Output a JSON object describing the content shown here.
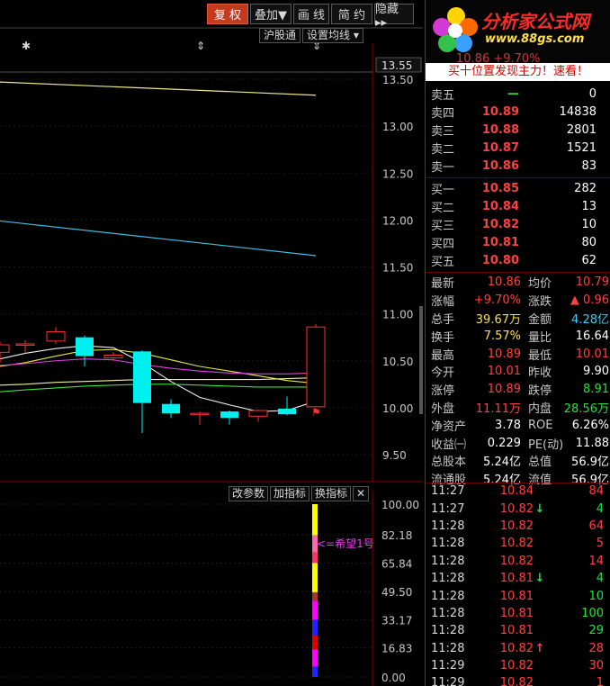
{
  "toolbar": {
    "buttons": [
      "复 权",
      "叠加▼",
      "画 线",
      "简 约",
      "隐藏 ▸▸"
    ]
  },
  "chart_header": {
    "hgt": "沪股通",
    "ma_setting": "设置均线 ▾",
    "markers": [
      "✱",
      "⇕",
      "⇕"
    ]
  },
  "price_axis": {
    "current": "13.55",
    "ticks": [
      "13.50",
      "13.00",
      "12.50",
      "12.00",
      "11.50",
      "11.00",
      "10.50",
      "10.00",
      "9.50"
    ]
  },
  "indicator_axis": {
    "ticks": [
      "100.00",
      "82.18",
      "65.84",
      "49.50",
      "33.17",
      "16.83",
      "0.00"
    ]
  },
  "indicator_toolbar": {
    "buttons": [
      "改参数",
      "加指标",
      "换指标"
    ],
    "close": "✕"
  },
  "indicator_label": "<=希望1号",
  "limit_flag": "⚑",
  "chart_data": {
    "type": "candlestick",
    "candles": [
      {
        "open": 10.59,
        "close": 10.67,
        "high": 10.7,
        "low": 10.48,
        "color": "red"
      },
      {
        "open": 10.67,
        "close": 10.68,
        "high": 10.72,
        "low": 10.58,
        "color": "red"
      },
      {
        "open": 10.71,
        "close": 10.81,
        "high": 10.86,
        "low": 10.68,
        "color": "red"
      },
      {
        "open": 10.75,
        "close": 10.55,
        "high": 10.77,
        "low": 10.44,
        "color": "cyan"
      },
      {
        "open": 10.56,
        "close": 10.53,
        "high": 10.59,
        "low": 10.5,
        "color": "red"
      },
      {
        "open": 10.6,
        "close": 10.05,
        "high": 10.61,
        "low": 9.73,
        "color": "cyan"
      },
      {
        "open": 10.04,
        "close": 9.94,
        "high": 10.09,
        "low": 9.89,
        "color": "cyan"
      },
      {
        "open": 9.93,
        "close": 9.94,
        "high": 9.96,
        "low": 9.82,
        "color": "red"
      },
      {
        "open": 9.96,
        "close": 9.89,
        "high": 9.97,
        "low": 9.82,
        "color": "cyan"
      },
      {
        "open": 9.91,
        "close": 9.97,
        "high": 9.98,
        "low": 9.85,
        "color": "red"
      },
      {
        "open": 9.99,
        "close": 9.93,
        "high": 10.12,
        "low": 9.92,
        "color": "cyan"
      },
      {
        "open": 10.01,
        "close": 10.86,
        "high": 10.89,
        "low": 10.01,
        "color": "red"
      }
    ],
    "ma_lines": [
      {
        "color": "#f0f0f0",
        "values": [
          10.52,
          10.58,
          10.63,
          10.66,
          10.64,
          10.48,
          10.28,
          10.11,
          10.03,
          9.96,
          9.97,
          10.07
        ]
      },
      {
        "color": "#e8e840",
        "values": [
          10.44,
          10.48,
          10.55,
          10.61,
          10.62,
          10.58,
          10.51,
          10.44,
          10.39,
          10.34,
          10.29,
          10.26
        ]
      },
      {
        "color": "#e040e0",
        "values": [
          10.45,
          10.47,
          10.5,
          10.52,
          10.51,
          10.46,
          10.42,
          10.39,
          10.37,
          10.36,
          10.36,
          10.37
        ]
      },
      {
        "color": "#40e040",
        "values": [
          10.17,
          10.19,
          10.21,
          10.23,
          10.24,
          10.25,
          10.25,
          10.24,
          10.23,
          10.22,
          10.22,
          10.22
        ]
      },
      {
        "color": "#f0f0a0",
        "values": [
          10.24,
          10.25,
          10.27,
          10.28,
          10.29,
          10.3,
          10.3,
          10.3,
          10.3,
          10.3,
          10.31,
          10.32
        ]
      }
    ],
    "long_ma_lines": [
      {
        "color": "#f0e68c",
        "from": 13.47,
        "to": 13.33
      },
      {
        "color": "#40c0e0",
        "from": 11.99,
        "to": 11.62
      }
    ],
    "indicator_bar": {
      "segments": [
        {
          "from": 82,
          "to": 100,
          "color": "#ffff00"
        },
        {
          "from": 72,
          "to": 82,
          "color": "#ff66aa"
        },
        {
          "from": 66,
          "to": 72,
          "color": "#ff3366"
        },
        {
          "from": 49,
          "to": 66,
          "color": "#ffff00"
        },
        {
          "from": 44,
          "to": 49,
          "color": "#aa3333"
        },
        {
          "from": 33,
          "to": 44,
          "color": "#ff00ff"
        },
        {
          "from": 24,
          "to": 33,
          "color": "#2222ff"
        },
        {
          "from": 16,
          "to": 24,
          "color": "#dd0000"
        },
        {
          "from": 6,
          "to": 16,
          "color": "#ff00ff"
        },
        {
          "from": 0,
          "to": 6,
          "color": "#2222ff"
        }
      ]
    }
  },
  "logo": {
    "title": "分析家公式网",
    "url": "www.88gs.com",
    "price_peek": "10.86   +9.70%"
  },
  "banner": "买十位置发现主力！速看！",
  "sell": [
    {
      "label": "卖五",
      "price": "—",
      "vol": "0"
    },
    {
      "label": "卖四",
      "price": "10.89",
      "vol": "14838"
    },
    {
      "label": "卖三",
      "price": "10.88",
      "vol": "2801"
    },
    {
      "label": "卖二",
      "price": "10.87",
      "vol": "1521"
    },
    {
      "label": "卖一",
      "price": "10.86",
      "vol": "83"
    }
  ],
  "buy": [
    {
      "label": "买一",
      "price": "10.85",
      "vol": "282"
    },
    {
      "label": "买二",
      "price": "10.84",
      "vol": "13"
    },
    {
      "label": "买三",
      "price": "10.82",
      "vol": "10"
    },
    {
      "label": "买四",
      "price": "10.81",
      "vol": "80"
    },
    {
      "label": "买五",
      "price": "10.80",
      "vol": "62"
    }
  ],
  "stats": [
    {
      "l1": "最新",
      "v1": "10.86",
      "c1": "red",
      "l2": "均价",
      "v2": "10.79",
      "c2": "red"
    },
    {
      "l1": "涨幅",
      "v1": "+9.70%",
      "c1": "red",
      "l2": "涨跌",
      "v2": "▲ 0.96",
      "c2": "red"
    },
    {
      "l1": "总手",
      "v1": "39.67万",
      "c1": "yellow",
      "l2": "金额",
      "v2": "4.28亿",
      "c2": "cyan"
    },
    {
      "l1": "换手",
      "v1": "7.57%",
      "c1": "yellow",
      "l2": "量比",
      "v2": "16.64",
      "c2": "white"
    },
    {
      "l1": "最高",
      "v1": "10.89",
      "c1": "red",
      "l2": "最低",
      "v2": "10.01",
      "c2": "red"
    },
    {
      "l1": "今开",
      "v1": "10.01",
      "c1": "red",
      "l2": "昨收",
      "v2": "9.90",
      "c2": "white"
    },
    {
      "l1": "涨停",
      "v1": "10.89",
      "c1": "red",
      "l2": "跌停",
      "v2": "8.91",
      "c2": "green"
    },
    {
      "l1": "外盘",
      "v1": "11.11万",
      "c1": "red",
      "l2": "内盘",
      "v2": "28.56万",
      "c2": "green"
    },
    {
      "l1": "净资产",
      "v1": "3.78",
      "c1": "white",
      "l2": "ROE",
      "v2": "6.26%",
      "c2": "white"
    },
    {
      "l1": "收益㈠",
      "v1": "0.229",
      "c1": "white",
      "l2": "PE(动)",
      "v2": "11.88",
      "c2": "white"
    },
    {
      "l1": "总股本",
      "v1": "5.24亿",
      "c1": "white",
      "l2": "总值",
      "v2": "56.9亿",
      "c2": "white"
    },
    {
      "l1": "流通股",
      "v1": "5.24亿",
      "c1": "white",
      "l2": "流值",
      "v2": "56.9亿",
      "c2": "white"
    }
  ],
  "ticks": [
    {
      "t": "11:27",
      "p": "10.84",
      "ar": "",
      "v": "84",
      "c": "red"
    },
    {
      "t": "11:27",
      "p": "10.82",
      "ar": "↓",
      "arc": "green",
      "v": "4",
      "c": "green"
    },
    {
      "t": "11:28",
      "p": "10.82",
      "ar": "",
      "v": "64",
      "c": "red"
    },
    {
      "t": "11:28",
      "p": "10.82",
      "ar": "",
      "v": "5",
      "c": "red"
    },
    {
      "t": "11:28",
      "p": "10.82",
      "ar": "",
      "v": "14",
      "c": "red"
    },
    {
      "t": "11:28",
      "p": "10.81",
      "ar": "↓",
      "arc": "green",
      "v": "4",
      "c": "green"
    },
    {
      "t": "11:28",
      "p": "10.81",
      "ar": "",
      "v": "10",
      "c": "green"
    },
    {
      "t": "11:28",
      "p": "10.81",
      "ar": "",
      "v": "100",
      "c": "green"
    },
    {
      "t": "11:28",
      "p": "10.81",
      "ar": "",
      "v": "29",
      "c": "green"
    },
    {
      "t": "11:28",
      "p": "10.82",
      "ar": "↑",
      "arc": "red",
      "v": "28",
      "c": "red"
    },
    {
      "t": "11:29",
      "p": "10.82",
      "ar": "",
      "v": "30",
      "c": "red"
    },
    {
      "t": "11:29",
      "p": "10.82",
      "ar": "",
      "v": "1",
      "c": "red"
    }
  ]
}
